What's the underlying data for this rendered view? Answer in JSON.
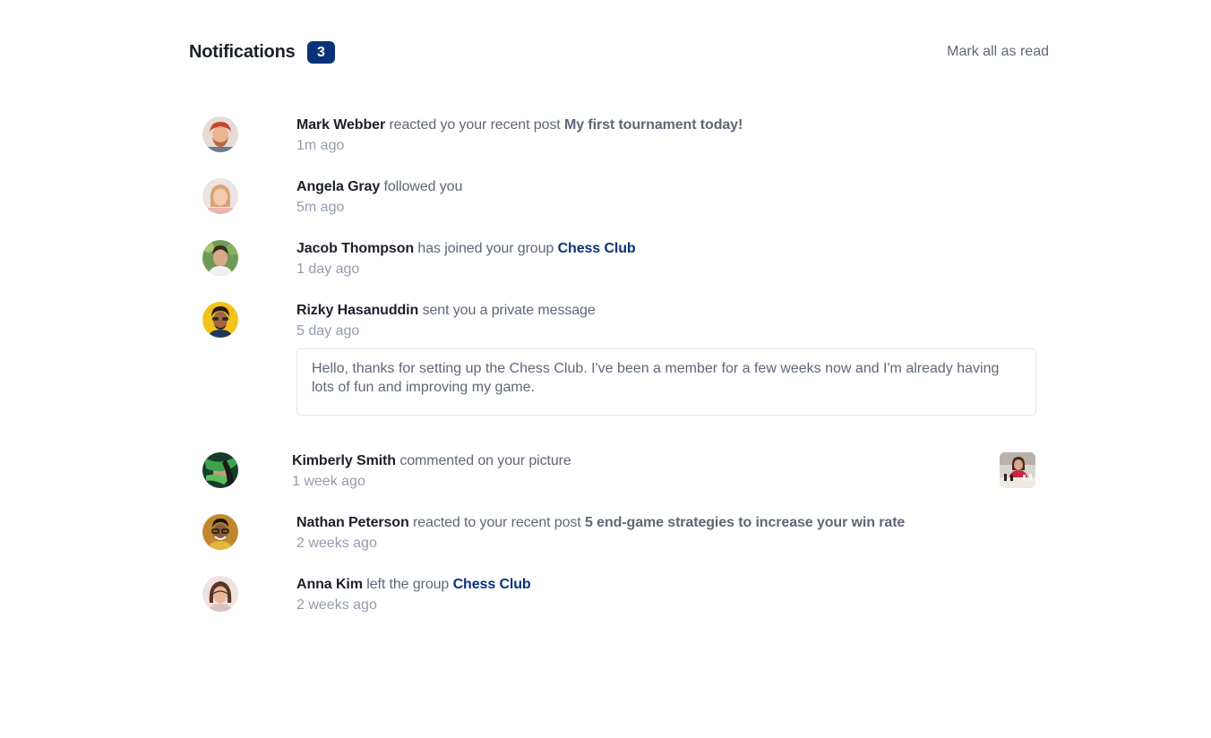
{
  "header": {
    "title": "Notifications",
    "unread_count": "3",
    "mark_all_label": "Mark all as read"
  },
  "colors": {
    "accent": "#0a327b",
    "heading": "#1c202b",
    "body_text": "#5e6778",
    "muted_text": "#939cad",
    "border": "#dde7ee"
  },
  "notifications": [
    {
      "avatar_icon": "user-avatar-mark",
      "user": "Mark Webber",
      "action": "reacted yo your recent post",
      "target": "My first tournament today!",
      "time": "1m ago"
    },
    {
      "avatar_icon": "user-avatar-angela",
      "user": "Angela Gray",
      "action": "followed you",
      "time": "5m ago"
    },
    {
      "avatar_icon": "user-avatar-jacob",
      "user": "Jacob Thompson",
      "action": "has joined your group",
      "target": "Chess Club",
      "time": "1 day ago"
    },
    {
      "avatar_icon": "user-avatar-rizky",
      "user": "Rizky Hasanuddin",
      "action": "sent you a private message",
      "time": "5 day ago",
      "message": "Hello, thanks for setting up the Chess Club. I've been a member for a few weeks now and I'm already having lots of fun and improving my game."
    },
    {
      "avatar_icon": "user-avatar-kimberly",
      "user": "Kimberly Smith",
      "action": "commented on your picture",
      "time": "1 week ago",
      "picture_icon": "chess-picture-thumbnail"
    },
    {
      "avatar_icon": "user-avatar-nathan",
      "user": "Nathan Peterson",
      "action": "reacted to your recent post",
      "target": "5 end-game strategies to increase your win rate",
      "time": "2 weeks ago"
    },
    {
      "avatar_icon": "user-avatar-anna",
      "user": "Anna Kim",
      "action": "left the group",
      "target": "Chess Club",
      "time": "2 weeks ago"
    }
  ]
}
